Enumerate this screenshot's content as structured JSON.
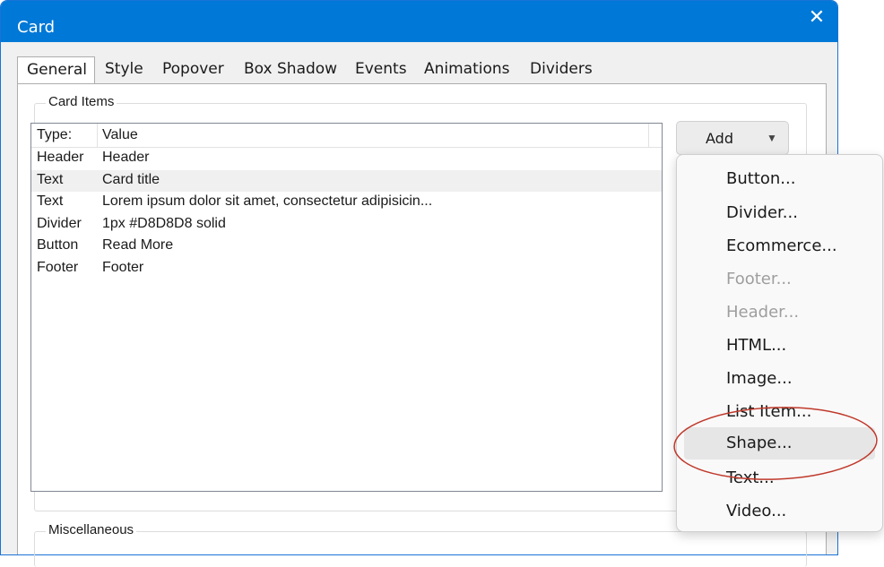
{
  "window": {
    "title": "Card",
    "close_glyph": "✕"
  },
  "tabs": [
    {
      "label": "General",
      "active": true
    },
    {
      "label": "Style"
    },
    {
      "label": "Popover"
    },
    {
      "label": "Box Shadow"
    },
    {
      "label": "Events"
    },
    {
      "label": "Animations"
    },
    {
      "label": "Dividers"
    }
  ],
  "card_items": {
    "group_label": "Card Items",
    "columns": [
      "Type:",
      "Value"
    ],
    "rows": [
      {
        "type": "Header",
        "value": "Header"
      },
      {
        "type": "Text",
        "value": "Card title",
        "selected": true
      },
      {
        "type": "Text",
        "value": "Lorem ipsum dolor sit amet, consectetur adipisicin..."
      },
      {
        "type": "Divider",
        "value": "1px #D8D8D8 solid"
      },
      {
        "type": "Button",
        "value": "Read More"
      },
      {
        "type": "Footer",
        "value": "Footer"
      }
    ]
  },
  "misc": {
    "group_label": "Miscellaneous"
  },
  "add_button": {
    "label": "Add",
    "caret": "▼"
  },
  "add_menu": {
    "items": [
      {
        "label": "Button...",
        "enabled": true
      },
      {
        "label": "Divider...",
        "enabled": true
      },
      {
        "label": "Ecommerce...",
        "enabled": true
      },
      {
        "label": "Footer...",
        "enabled": false
      },
      {
        "label": "Header...",
        "enabled": false
      },
      {
        "label": "HTML...",
        "enabled": true
      },
      {
        "label": "Image...",
        "enabled": true
      },
      {
        "label": "List Item...",
        "enabled": true
      },
      {
        "label": "Shape...",
        "enabled": true,
        "highlighted": true
      },
      {
        "label": "Text...",
        "enabled": true
      },
      {
        "label": "Video...",
        "enabled": true
      }
    ]
  },
  "colors": {
    "titlebar": "#0078d7",
    "annotation_circle": "#c0392b",
    "disabled_text": "#9e9e9e"
  }
}
